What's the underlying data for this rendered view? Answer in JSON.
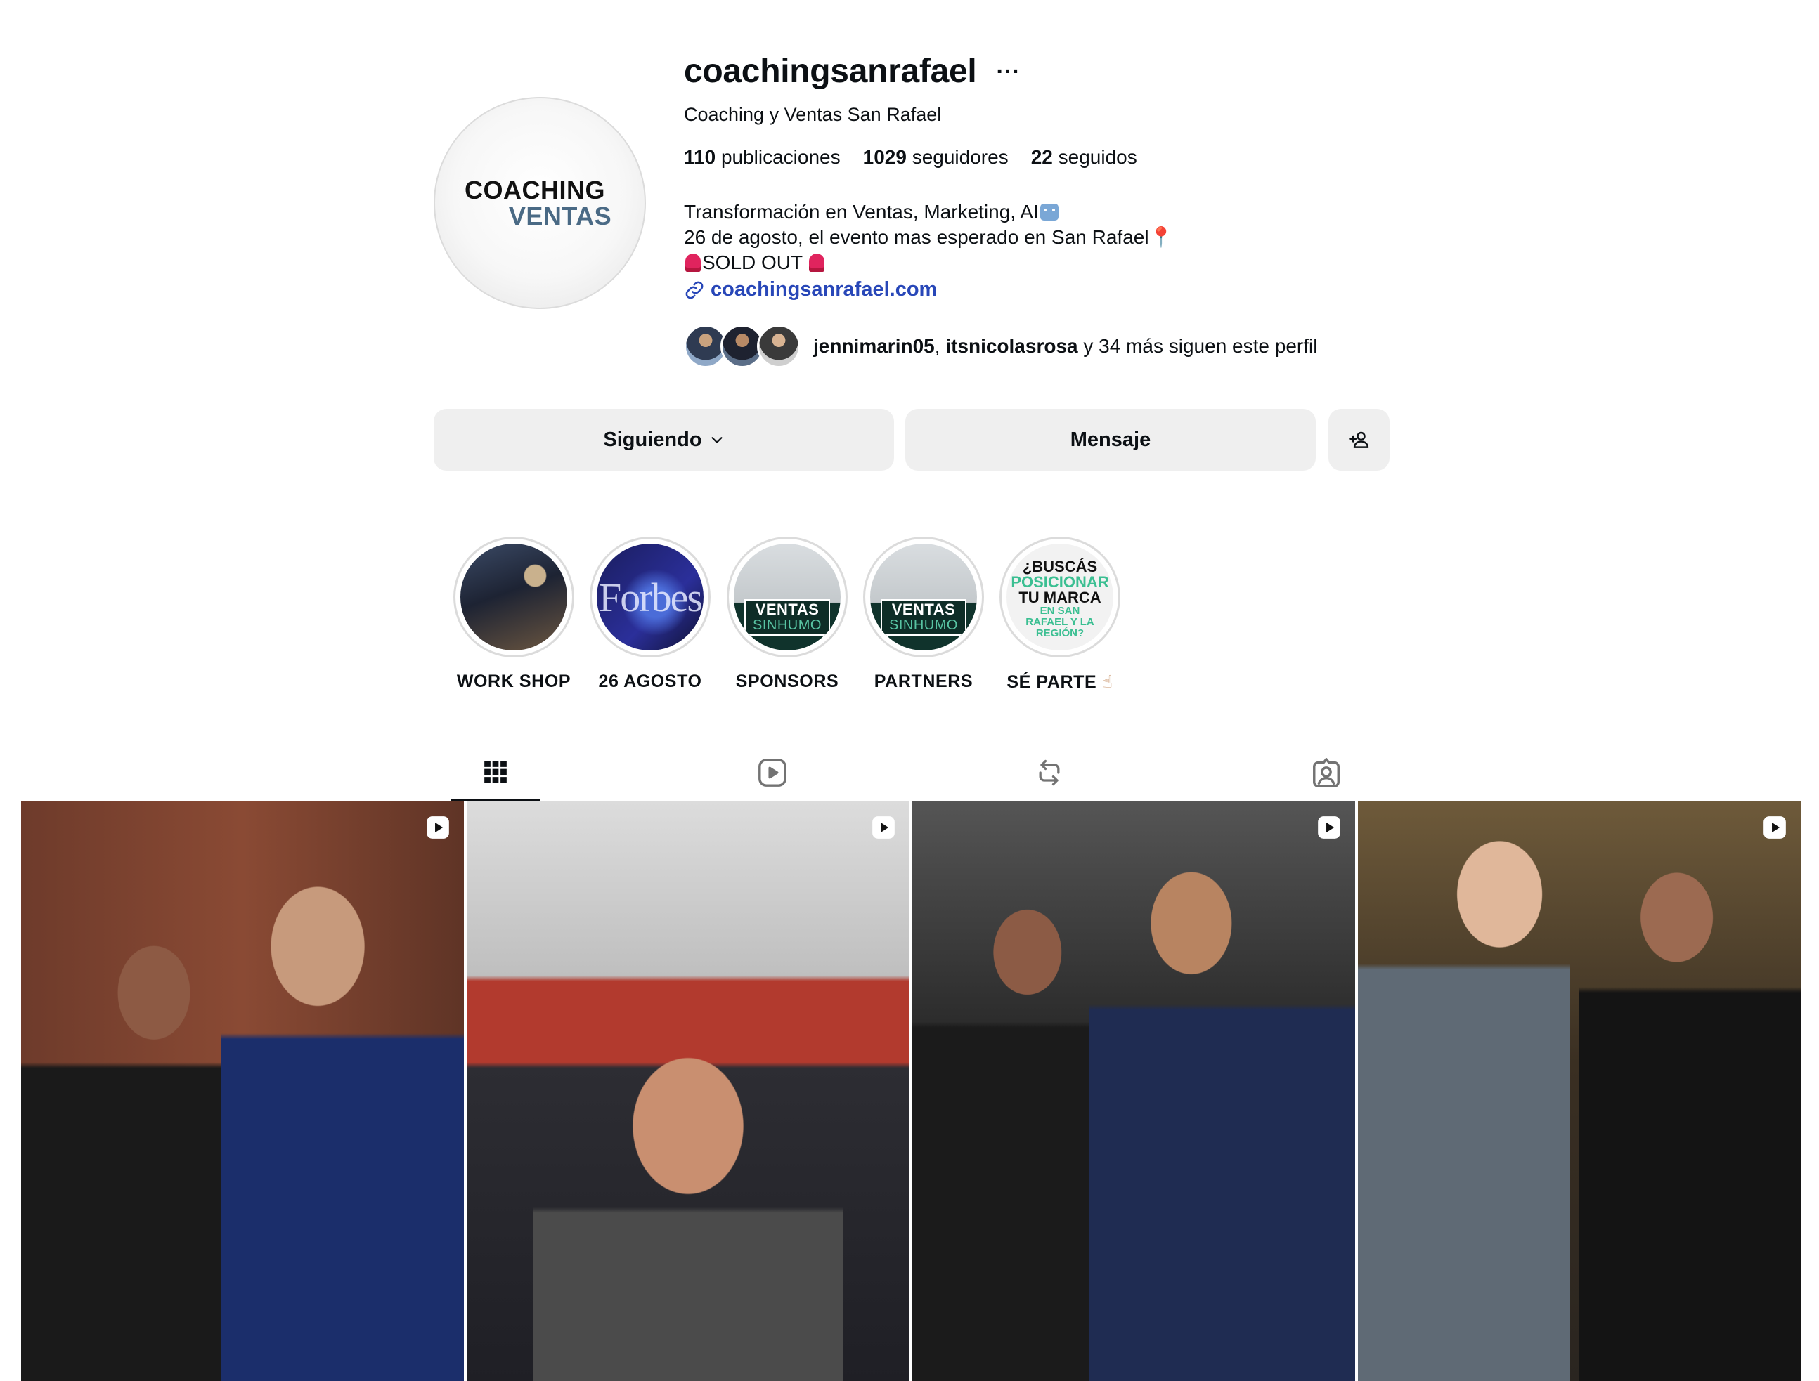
{
  "profile": {
    "username": "coachingsanrafael",
    "more_label": "···",
    "full_name": "Coaching y Ventas San Rafael",
    "avatar_logo": {
      "line1": "COACHING",
      "line2": "VENTAS"
    },
    "stats": {
      "posts_count": "110",
      "posts_label": "publicaciones",
      "followers_count": "1029",
      "followers_label": "seguidores",
      "following_count": "22",
      "following_label": "seguidos"
    },
    "bio": {
      "line1": "Transformación en Ventas, Marketing, AI",
      "line2": "26 de agosto, el evento mas esperado en San Rafael",
      "line3": "SOLD OUT"
    },
    "link": "coachingsanrafael.com",
    "followed_by": {
      "user1": "jennimarin05",
      "separator": ", ",
      "user2": "itsnicolasrosa",
      "rest": " y 34 más siguen este perfil"
    }
  },
  "actions": {
    "following_label": "Siguiendo",
    "message_label": "Mensaje"
  },
  "highlights": [
    {
      "label": "WORK SHOP"
    },
    {
      "label": "26 AGOSTO",
      "image_text": "Forbes"
    },
    {
      "label": "SPONSORS",
      "image_text_1": "VENTAS",
      "image_text_2": "SINHUMO"
    },
    {
      "label": "PARTNERS",
      "image_text_1": "VENTAS",
      "image_text_2": "SINHUMO"
    },
    {
      "label": "SÉ PARTE",
      "label_emoji": "☝",
      "image_text_1": "¿BUSCÁS",
      "image_text_2": "POSICIONAR",
      "image_text_3": "TU MARCA",
      "image_text_4": "EN SAN RAFAEL Y LA REGIÓN?"
    }
  ],
  "tabs": [
    {
      "icon": "grid-icon",
      "active": true
    },
    {
      "icon": "reels-icon",
      "active": false
    },
    {
      "icon": "reposts-icon",
      "active": false
    },
    {
      "icon": "tagged-icon",
      "active": false
    }
  ],
  "posts": [
    {
      "type": "reel"
    },
    {
      "type": "reel"
    },
    {
      "type": "reel"
    },
    {
      "type": "reel"
    }
  ],
  "colors": {
    "link": "#2847b8",
    "button_bg": "#efefef",
    "text": "#0c1014",
    "brand_green": "#3bbf92"
  }
}
